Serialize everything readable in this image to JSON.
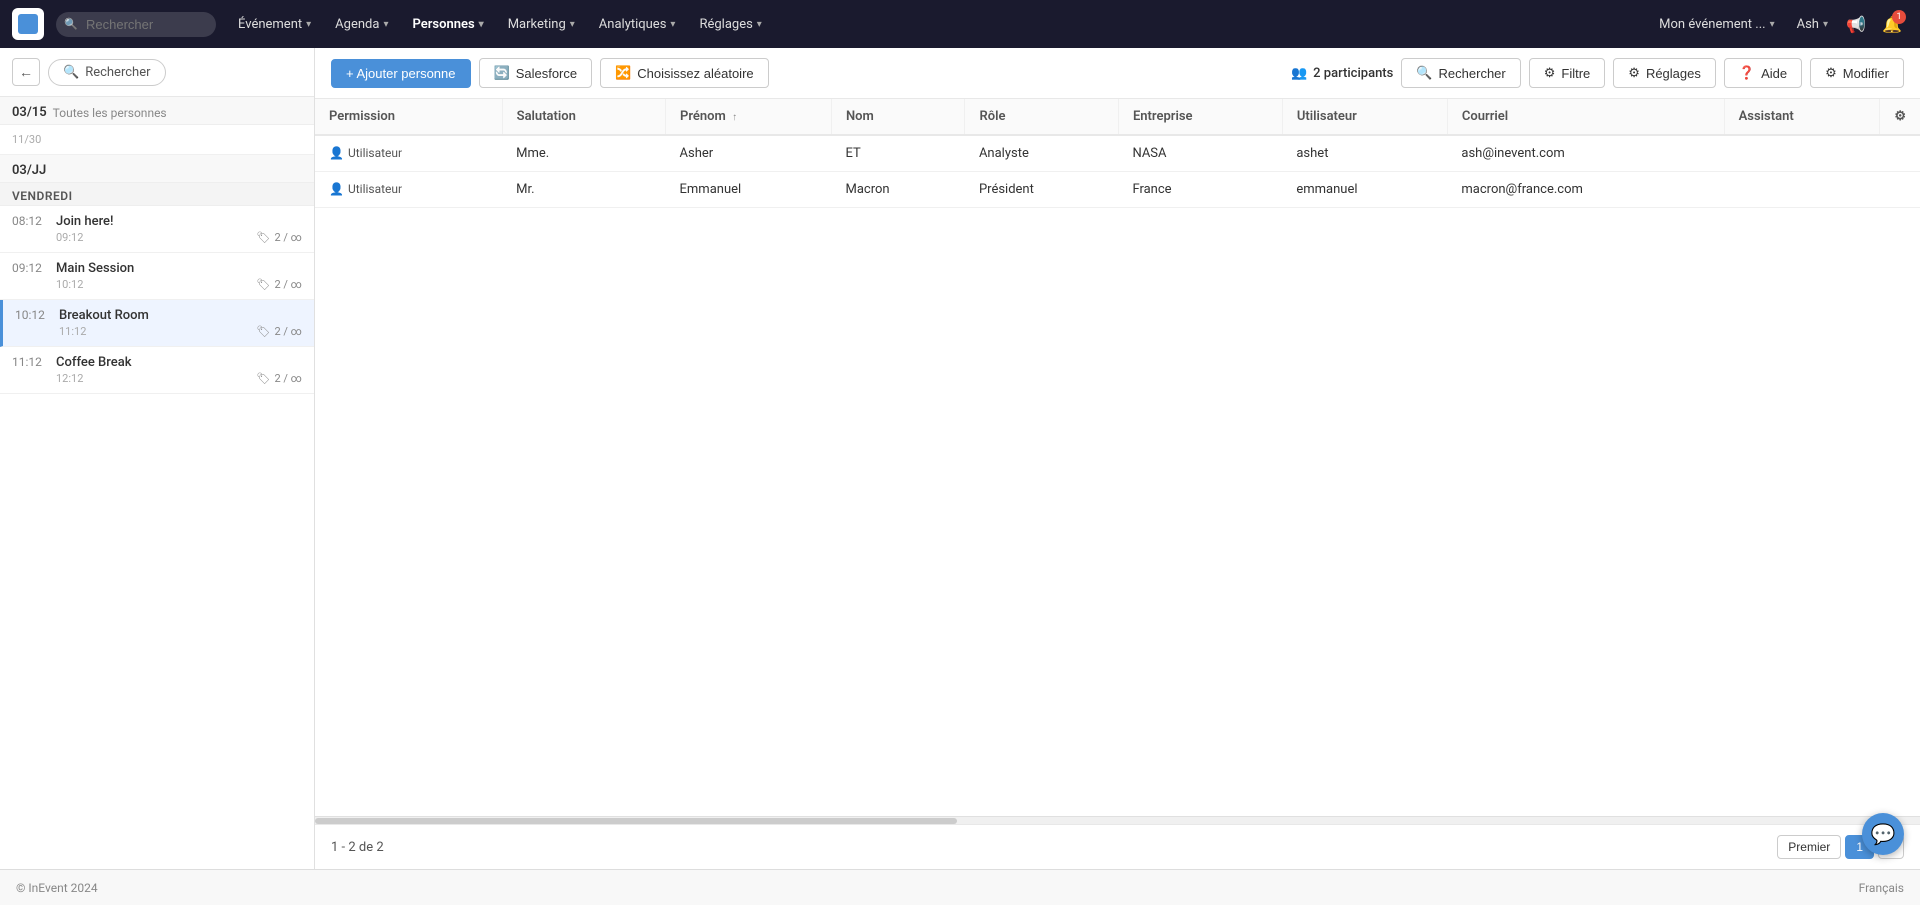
{
  "topnav": {
    "search_placeholder": "Rechercher",
    "nav_items": [
      {
        "label": "Événement",
        "id": "evenement"
      },
      {
        "label": "Agenda",
        "id": "agenda"
      },
      {
        "label": "Personnes",
        "id": "personnes"
      },
      {
        "label": "Marketing",
        "id": "marketing"
      },
      {
        "label": "Analytiques",
        "id": "analytiques"
      },
      {
        "label": "Réglages",
        "id": "reglages"
      }
    ],
    "mon_evenement_label": "Mon événement ...",
    "user_label": "Ash",
    "notification_count": "1"
  },
  "sidebar": {
    "search_label": "Rechercher",
    "back_label": "←",
    "date_groups": [
      {
        "date": "03/15",
        "sub": "Toutes les personnes",
        "sub2": "11/30",
        "days": []
      },
      {
        "date": "03/JJ",
        "label": "VENDREDI",
        "sessions": [
          {
            "start": "08:12",
            "name": "Join here!",
            "end": "09:12",
            "tags": "2 / ∞",
            "active": false
          },
          {
            "start": "09:12",
            "name": "Main Session",
            "end": "10:12",
            "tags": "2 / ∞",
            "active": false
          },
          {
            "start": "10:12",
            "name": "Breakout Room",
            "end": "11:12",
            "tags": "2 / ∞",
            "active": true
          },
          {
            "start": "11:12",
            "name": "Coffee Break",
            "end": "12:12",
            "tags": "2 / ∞",
            "active": false
          }
        ]
      }
    ]
  },
  "toolbar": {
    "add_person_label": "+ Ajouter personne",
    "salesforce_label": "Salesforce",
    "random_label": "Choisissez aléatoire",
    "participants_label": "2 participants",
    "search_label": "Rechercher",
    "filter_label": "Filtre",
    "settings_label": "Réglages",
    "help_label": "Aide",
    "modify_label": "Modifier"
  },
  "table": {
    "columns": [
      {
        "key": "permission",
        "label": "Permission"
      },
      {
        "key": "salutation",
        "label": "Salutation"
      },
      {
        "key": "prenom",
        "label": "Prénom",
        "sortable": true
      },
      {
        "key": "nom",
        "label": "Nom"
      },
      {
        "key": "role",
        "label": "Rôle"
      },
      {
        "key": "entreprise",
        "label": "Entreprise"
      },
      {
        "key": "utilisateur",
        "label": "Utilisateur"
      },
      {
        "key": "courriel",
        "label": "Courriel"
      },
      {
        "key": "assistant",
        "label": "Assistant"
      }
    ],
    "rows": [
      {
        "permission": "Utilisateur",
        "salutation": "Mme.",
        "prenom": "Asher",
        "nom": "ET",
        "role": "Analyste",
        "entreprise": "NASA",
        "utilisateur": "ashet",
        "courriel": "ash@inevent.com",
        "assistant": ""
      },
      {
        "permission": "Utilisateur",
        "salutation": "Mr.",
        "prenom": "Emmanuel",
        "nom": "Macron",
        "role": "Président",
        "entreprise": "France",
        "utilisateur": "emmanuel",
        "courriel": "macron@france.com",
        "assistant": ""
      }
    ]
  },
  "footer": {
    "pagination_info": "1 - 2 de 2",
    "premier_label": "Premier",
    "page_1_label": "1",
    "next_label": "›"
  },
  "bottom": {
    "copyright": "© InEvent 2024",
    "language": "Français"
  }
}
